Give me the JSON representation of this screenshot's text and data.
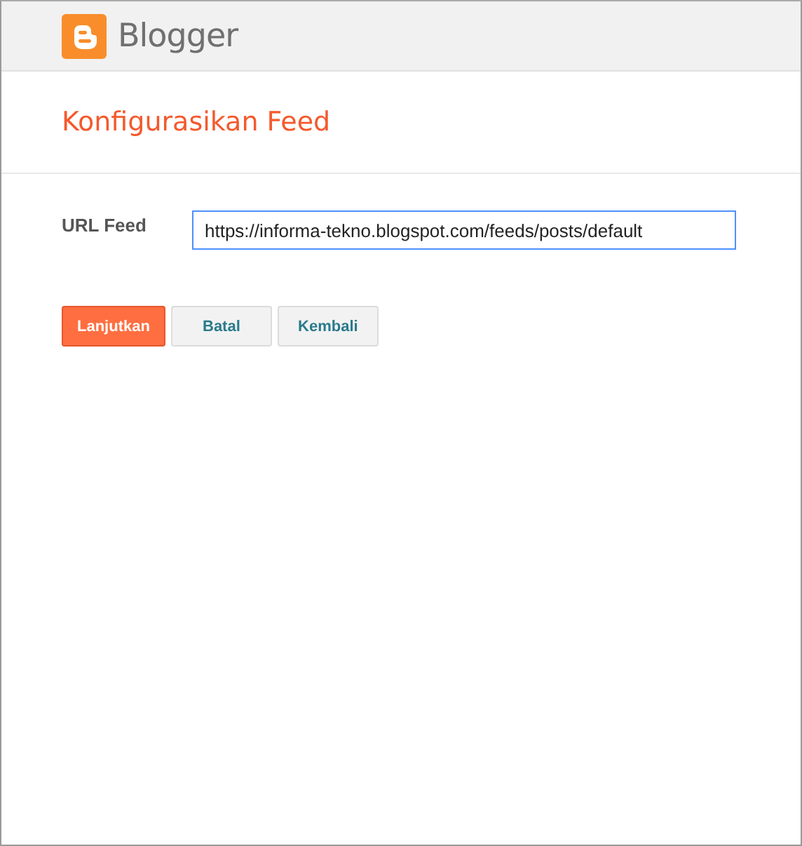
{
  "header": {
    "brand": "Blogger"
  },
  "title": "Konfigurasikan Feed",
  "form": {
    "label": "URL Feed",
    "value": "https://informa-tekno.blogspot.com/feeds/posts/default"
  },
  "buttons": [
    {
      "label": "Lanjutkan",
      "kind": "primary"
    },
    {
      "label": "Batal",
      "kind": "secondary"
    },
    {
      "label": "Kembali",
      "kind": "secondary"
    }
  ]
}
